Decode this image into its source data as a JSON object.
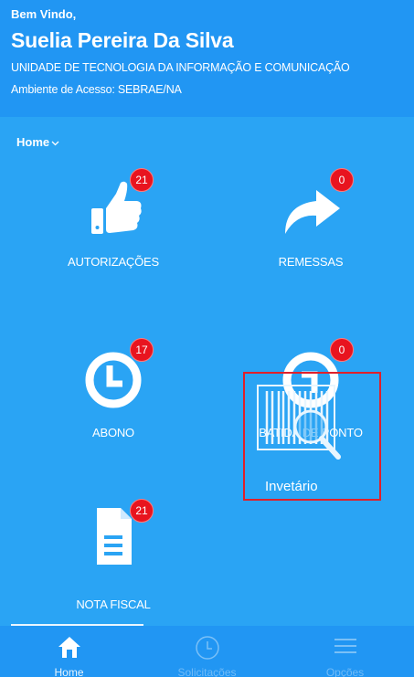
{
  "header": {
    "welcome": "Bem Vindo,",
    "user_name": "Suelia Pereira Da Silva",
    "unit": "UNIDADE DE TECNOLOGIA DA INFORMAÇÃO E COMUNICAÇÃO",
    "environment": "Ambiente de Acesso: SEBRAE/NA"
  },
  "breadcrumb": {
    "label": "Home",
    "icon": "chevron-down-icon"
  },
  "tiles": [
    {
      "label": "AUTORIZAÇÕES",
      "badge": "21",
      "icon": "thumbs-up-icon"
    },
    {
      "label": "REMESSAS",
      "badge": "0",
      "icon": "share-arrow-icon"
    },
    {
      "label": "ABONO",
      "badge": "17",
      "icon": "clock-icon"
    },
    {
      "label": "BATIDA DE PONTO",
      "badge": "0",
      "icon": "clock-icon"
    },
    {
      "label": "NOTA FISCAL",
      "badge": "21",
      "icon": "document-icon"
    },
    {
      "label": "Invetário",
      "icon": "barcode-search-icon"
    }
  ],
  "bottom_nav": [
    {
      "label": "Home",
      "icon": "home-icon",
      "active": true
    },
    {
      "label": "Solicitações",
      "icon": "clock-icon",
      "active": false
    },
    {
      "label": "Opções",
      "icon": "menu-icon",
      "active": false
    }
  ],
  "colors": {
    "header_bg": "#2196f3",
    "body_bg": "#2aa4f4",
    "badge": "#e8141f",
    "highlight_border": "#e0202a"
  }
}
